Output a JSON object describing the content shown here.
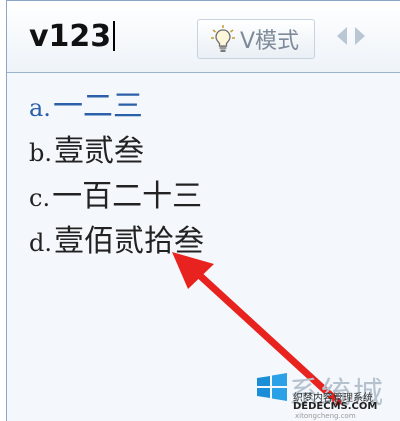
{
  "compose": {
    "input_text": "v123"
  },
  "toolbar": {
    "vmode_label": "V模式",
    "bulb_icon": "lightbulb-icon",
    "prev_icon": "arrow-left-icon",
    "next_icon": "arrow-right-icon"
  },
  "candidates": [
    {
      "key": "a.",
      "text": "一二三",
      "selected": true
    },
    {
      "key": "b.",
      "text": "壹贰叁",
      "selected": false
    },
    {
      "key": "c.",
      "text": "一百二十三",
      "selected": false
    },
    {
      "key": "d.",
      "text": "壹佰贰拾叁",
      "selected": false
    }
  ],
  "watermark": {
    "site_name": "系统城",
    "subtitle": "织梦内容管理系统",
    "domain": "DEDECMS.COM",
    "small": "xitongcheng.com"
  },
  "colors": {
    "selected_candidate": "#2b5fa8",
    "annotation_arrow": "#e8231f",
    "border": "#8aa8c6"
  }
}
